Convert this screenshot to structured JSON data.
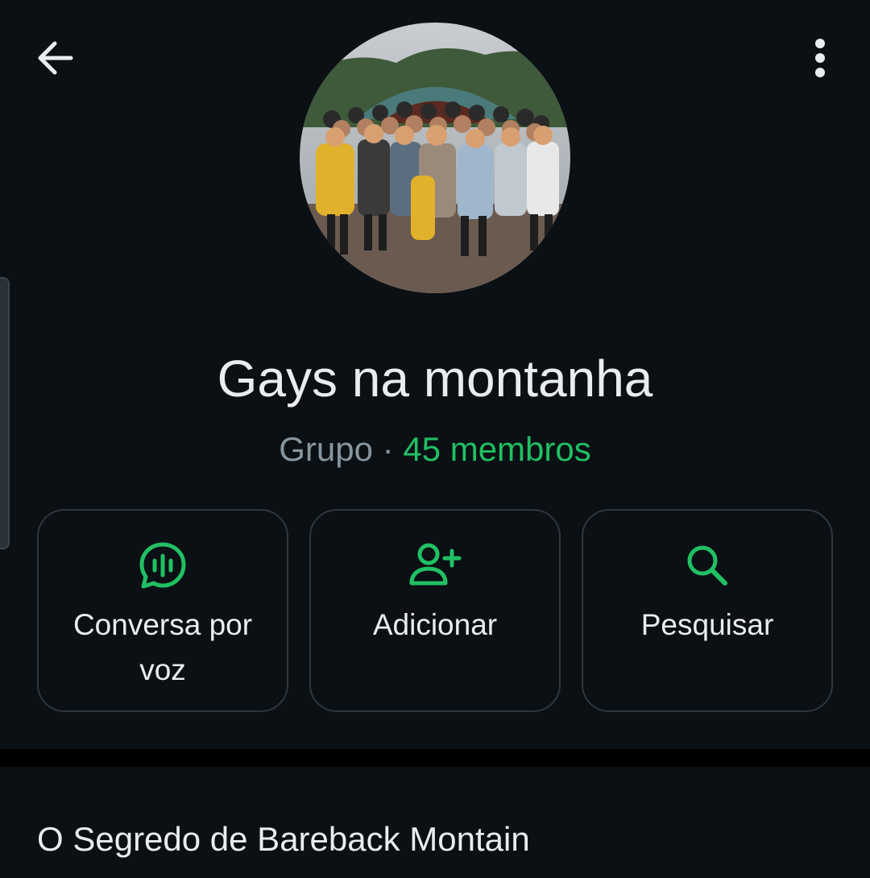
{
  "header": {
    "back_icon": "arrow-left-icon",
    "menu_icon": "more-vertical-icon"
  },
  "group": {
    "avatar_alt": "group-photo",
    "name": "Gays na montanha",
    "type_label": "Grupo",
    "separator": "·",
    "members_label": "45 membros"
  },
  "actions": [
    {
      "icon": "voice-chat-icon",
      "label": "Conversa por voz"
    },
    {
      "icon": "add-person-icon",
      "label": "Adicionar"
    },
    {
      "icon": "search-icon",
      "label": "Pesquisar"
    }
  ],
  "description": {
    "text": "O Segredo de Bareback Montain"
  },
  "colors": {
    "background": "#0b1014",
    "accent": "#21c063",
    "text_primary": "#e9edef",
    "text_secondary": "#8696a0"
  }
}
